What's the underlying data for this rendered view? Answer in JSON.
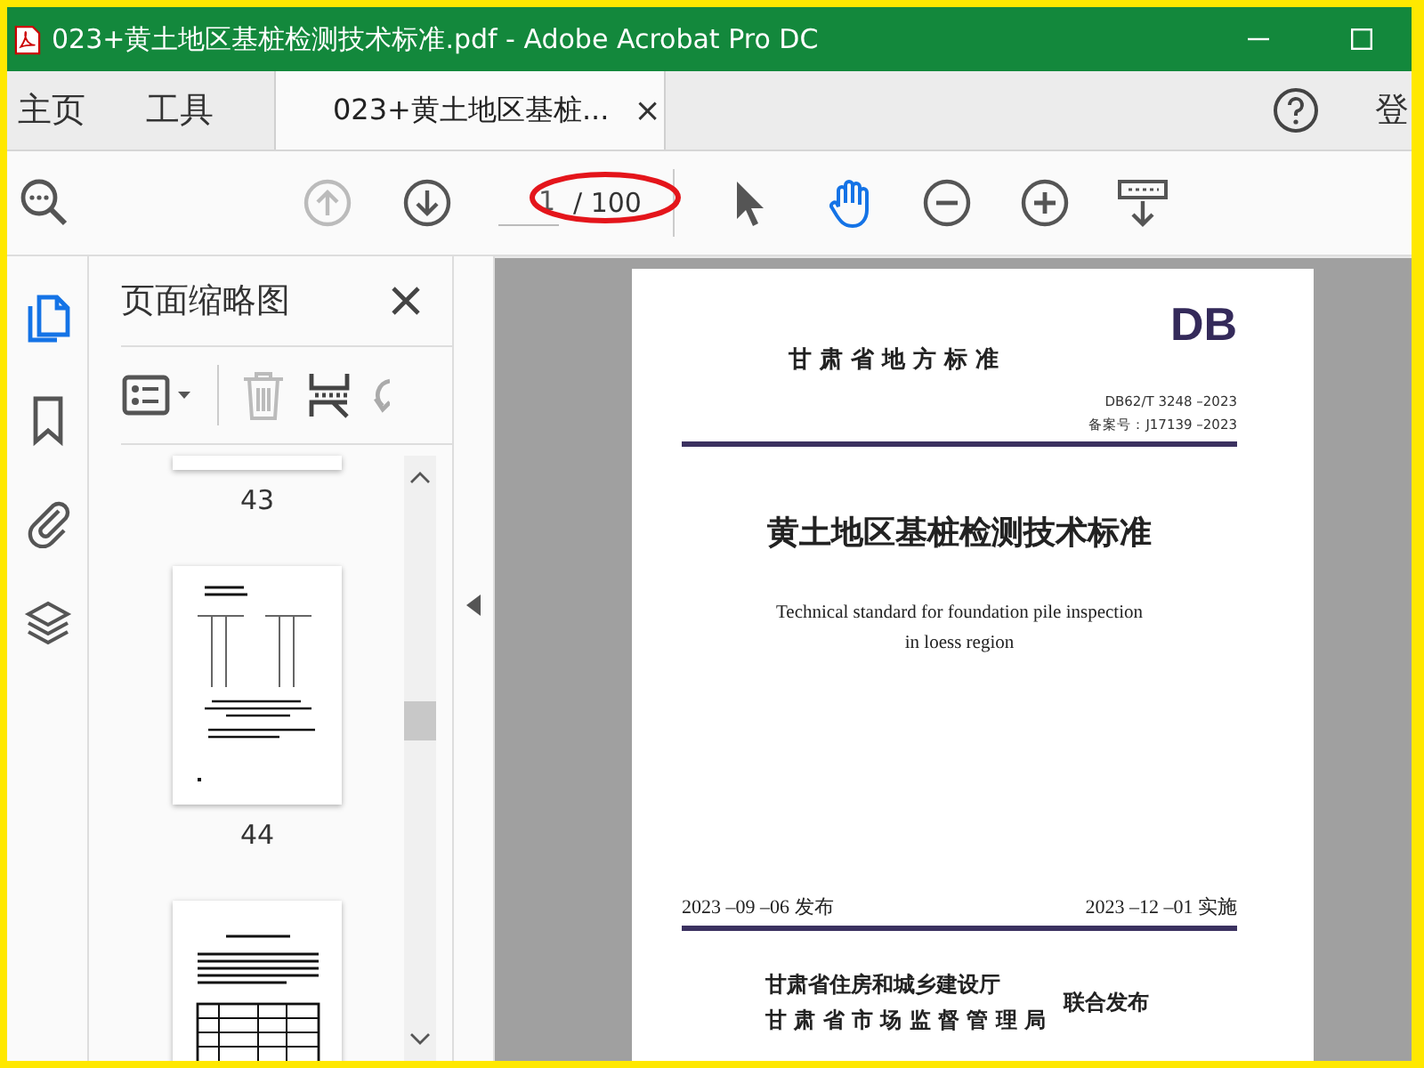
{
  "window": {
    "title": "023+黄土地区基桩检测技术标准.pdf - Adobe Acrobat Pro DC"
  },
  "nav_tabs": [
    {
      "label": "主页",
      "selected": false
    },
    {
      "label": "工具",
      "selected": false
    },
    {
      "label": "023+黄土地区基桩...",
      "selected": true,
      "close": "×"
    }
  ],
  "account": {
    "label": "登"
  },
  "toolbar": {
    "previous_page": {
      "disabled": true
    },
    "page_field": {
      "value": "1"
    },
    "page_total": "/ 100",
    "hand_tool": {
      "selected": true
    }
  },
  "side_rail": [
    {
      "kind": "pages",
      "selected": true
    },
    {
      "kind": "bookmark",
      "selected": false
    },
    {
      "kind": "attachment",
      "selected": false
    },
    {
      "kind": "layers",
      "selected": false
    }
  ],
  "thumbnails_panel": {
    "title": "页面缩略图",
    "delete": {
      "disabled": true
    },
    "thumbnails": [
      {
        "kind": "partial",
        "label": "43"
      },
      {
        "kind": "figure",
        "label": "44"
      },
      {
        "kind": "table"
      }
    ]
  },
  "document": {
    "series": "甘 肃 省 地 方 标 准",
    "code": "DB",
    "number": "DB62/T 3248 –2023",
    "record": "备案号：J17139 –2023",
    "title": "黄土地区基桩检测技术标准",
    "title_en_lines": [
      "Technical standard for foundation pile inspection",
      "in loess region"
    ],
    "issue_date": "2023 –09 –06 发布",
    "effective_date": "2023 –12 –01 实施",
    "publishers": [
      "甘肃省住房和城乡建设厅",
      "甘 肃 省 市 场 监 督 管 理 局"
    ],
    "joint": "联合发布"
  }
}
